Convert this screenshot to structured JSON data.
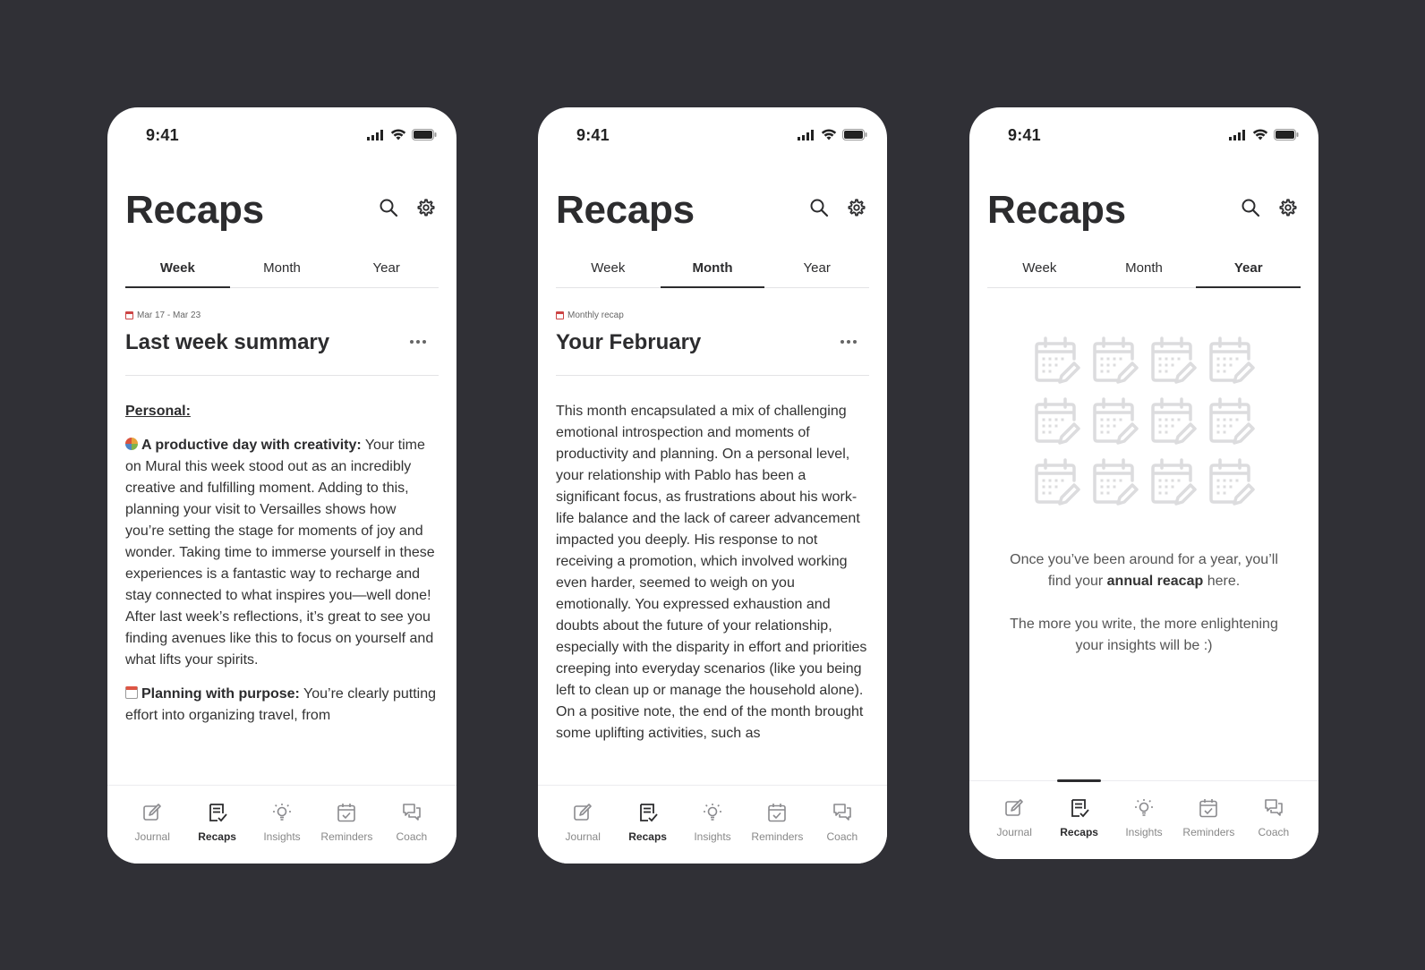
{
  "colors": {
    "background": "#303036",
    "text": "#2c2c2e",
    "muted": "#888888",
    "divider": "#e3e3e6",
    "calendar_placeholder": "#dcdcde"
  },
  "common": {
    "time": "9:41",
    "title": "Recaps",
    "tabs": [
      "Week",
      "Month",
      "Year"
    ],
    "nav": [
      {
        "label": "Journal",
        "icon": "journal-edit-icon"
      },
      {
        "label": "Recaps",
        "icon": "recaps-checklist-icon"
      },
      {
        "label": "Insights",
        "icon": "lightbulb-icon"
      },
      {
        "label": "Reminders",
        "icon": "calendar-check-icon"
      },
      {
        "label": "Coach",
        "icon": "chat-bubbles-icon"
      }
    ]
  },
  "week": {
    "active_tab": "Week",
    "date_range": "Mar 17 - Mar 23",
    "title": "Last week summary",
    "section": "Personal:",
    "items": [
      {
        "emoji": "palette-emoji",
        "heading": "A productive day with creativity:",
        "text": " Your time on Mural this week stood out as an incredibly creative and fulfilling moment. Adding to this, planning your visit to Versailles shows how you’re setting the stage for moments of joy and wonder. Taking time to immerse yourself in these experiences is a fantastic way to recharge and stay connected to what inspires you—well done! After last week’s reflections, it’s great to see you finding avenues like this to focus on yourself and what lifts your spirits."
      },
      {
        "emoji": "calendar-emoji",
        "heading": "Planning with purpose:",
        "text": " You’re clearly putting effort into organizing travel, from"
      }
    ]
  },
  "month": {
    "active_tab": "Month",
    "label": "Monthly recap",
    "title": "Your February",
    "text": "This month encapsulated a mix of challenging emotional introspection and moments of productivity and planning. On a personal level, your relationship with Pablo has been a significant focus, as frustrations about his work-life balance and the lack of career advancement impacted you deeply. His response to not receiving a promotion, which involved working even harder, seemed to weigh on you emotionally. You expressed exhaustion and doubts about the future of your relationship, especially with the disparity in effort and priorities creeping into everyday scenarios (like you being left to clean up or manage the household alone). On a positive note, the end of the month brought some uplifting activities, such as"
  },
  "year": {
    "active_tab": "Year",
    "empty_line1_prefix": "Once you’ve been around for a year, you’ll find your ",
    "empty_line1_bold": "annual reacap",
    "empty_line1_suffix": " here.",
    "empty_line2": "The more you write, the more enlightening your insights will be :)",
    "calendar_placeholder_count": 12
  }
}
